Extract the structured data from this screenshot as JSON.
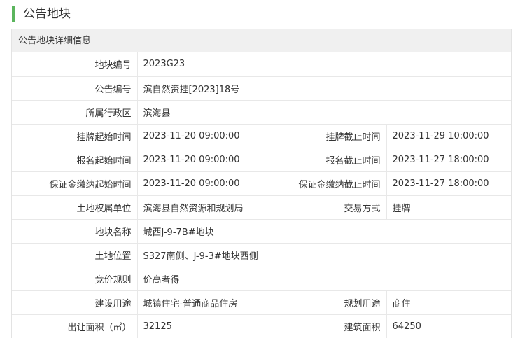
{
  "page_title": "公告地块",
  "panel_title": "公告地块详细信息",
  "rows": [
    {
      "label": "地块编号",
      "value": "2023G23"
    },
    {
      "label": "公告编号",
      "value": "滨自然资挂[2023]18号"
    },
    {
      "label": "所属行政区",
      "value": "滨海县"
    },
    {
      "label": "挂牌起始时间",
      "value": "2023-11-20 09:00:00",
      "label2": "挂牌截止时间",
      "value2": "2023-11-29 10:00:00"
    },
    {
      "label": "报名起始时间",
      "value": "2023-11-20 09:00:00",
      "label2": "报名截止时间",
      "value2": "2023-11-27 18:00:00"
    },
    {
      "label": "保证金缴纳起始时间",
      "value": "2023-11-20 09:00:00",
      "label2": "保证金缴纳截止时间",
      "value2": "2023-11-27 18:00:00"
    },
    {
      "label": "土地权属单位",
      "value": "滨海县自然资源和规划局",
      "label2": "交易方式",
      "value2": "挂牌"
    },
    {
      "label": "地块名称",
      "value": "城西J-9-7B#地块"
    },
    {
      "label": "土地位置",
      "value": "S327南侧、J-9-3#地块西侧"
    },
    {
      "label": "竞价规则",
      "value": "价高者得"
    },
    {
      "label": "建设用途",
      "value": "城镇住宅-普通商品住房",
      "label2": "规划用途",
      "value2": "商住"
    },
    {
      "label": "出让面积（㎡）",
      "value": "32125",
      "label2": "建筑面积",
      "value2": "64250"
    }
  ]
}
